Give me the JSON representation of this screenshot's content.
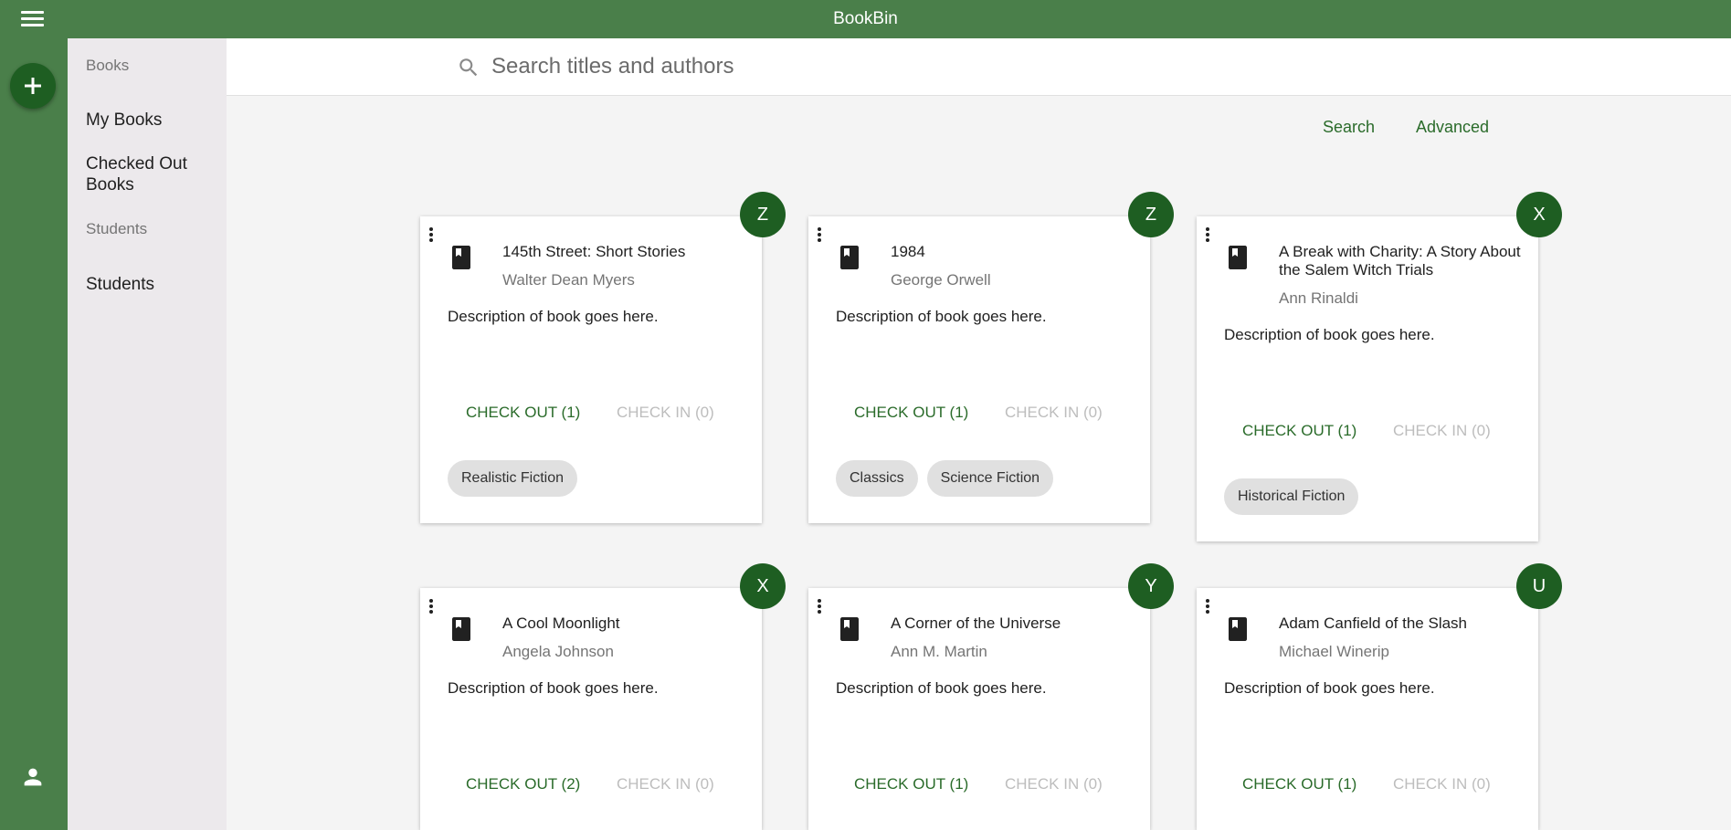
{
  "app": {
    "title": "BookBin"
  },
  "drawer": {
    "books_header": "Books",
    "my_books": "My Books",
    "checked_out_books": "Checked Out Books",
    "students_header": "Students",
    "students": "Students"
  },
  "search": {
    "placeholder": "Search titles and authors",
    "value": ""
  },
  "actions": {
    "search_label": "Search",
    "advanced_label": "Advanced"
  },
  "colors": {
    "bar": "#4a7f4a",
    "accent": "#1e5e22",
    "link": "#2a6b2a"
  },
  "cards": [
    {
      "title": "145th Street: Short Stories",
      "author": "Walter Dean Myers",
      "description": "Description of book goes here.",
      "checkout": "CHECK OUT (1)",
      "checkin": "CHECK IN (0)",
      "avatar": "Z",
      "tags": [
        "Realistic Fiction"
      ]
    },
    {
      "title": "1984",
      "author": "George Orwell",
      "description": "Description of book goes here.",
      "checkout": "CHECK OUT (1)",
      "checkin": "CHECK IN (0)",
      "avatar": "Z",
      "tags": [
        "Classics",
        "Science Fiction"
      ]
    },
    {
      "title": "A Break with Charity: A Story About the Salem Witch Trials",
      "author": "Ann Rinaldi",
      "description": "Description of book goes here.",
      "checkout": "CHECK OUT (1)",
      "checkin": "CHECK IN (0)",
      "avatar": "X",
      "tags": [
        "Historical Fiction"
      ]
    },
    {
      "title": "A Cool Moonlight",
      "author": "Angela Johnson",
      "description": "Description of book goes here.",
      "checkout": "CHECK OUT (2)",
      "checkin": "CHECK IN (0)",
      "avatar": "X",
      "tags": []
    },
    {
      "title": "A Corner of the Universe",
      "author": "Ann M. Martin",
      "description": "Description of book goes here.",
      "checkout": "CHECK OUT (1)",
      "checkin": "CHECK IN (0)",
      "avatar": "Y",
      "tags": []
    },
    {
      "title": "Adam Canfield of the Slash",
      "author": "Michael Winerip",
      "description": "Description of book goes here.",
      "checkout": "CHECK OUT (1)",
      "checkin": "CHECK IN (0)",
      "avatar": "U",
      "tags": []
    }
  ]
}
